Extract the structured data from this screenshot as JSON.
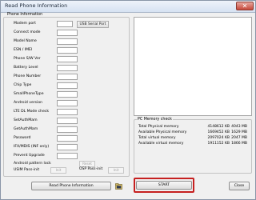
{
  "window": {
    "title": "Read Phone Information",
    "close_glyph": "✕"
  },
  "phone_info": {
    "group_title": "Phone Information",
    "fields": [
      "Modem port",
      "Connect mode",
      "Model Name",
      "ESN / IMEI",
      "Phone S/W Ver",
      "Battery Level",
      "Phone Number",
      "Chip Type",
      "SmallPhoneType",
      "Android version",
      "LTE DL Mode check",
      "SetAuthMam",
      "GetAuthMam",
      "Password",
      "IFX/MDIS (INF only)",
      "Prevent Upgrade"
    ],
    "usb_serial_port_label": "USB Serial Port",
    "android_pattern_lock_label": "Android pattern lock",
    "reset_label": "Reset",
    "usim_pass_init_label": "USIM Pass-init",
    "osp_pass_init_label": "OSP Pass-init",
    "init_label": "Init"
  },
  "memory": {
    "title": "PC Memory check",
    "rows": [
      {
        "label": "Total Physical memory",
        "value_kb": "4148612 KB",
        "value_mb": "4043 MB"
      },
      {
        "label": "Available Physical memory",
        "value_kb": "1669452 KB",
        "value_mb": "1629 MB"
      },
      {
        "label": "Total virtual memory",
        "value_kb": "2097024 KB",
        "value_mb": "2047 MB"
      },
      {
        "label": "Available virtual memory",
        "value_kb": "1911152 KB",
        "value_mb": "1866 MB"
      }
    ]
  },
  "buttons": {
    "read_phone_info": "Read Phone Information",
    "start": "START",
    "close": "Close"
  },
  "icons": {
    "folder": "folder-icon"
  },
  "colors": {
    "start_highlight": "#c62020",
    "titlebar": "#dbe6f4"
  }
}
